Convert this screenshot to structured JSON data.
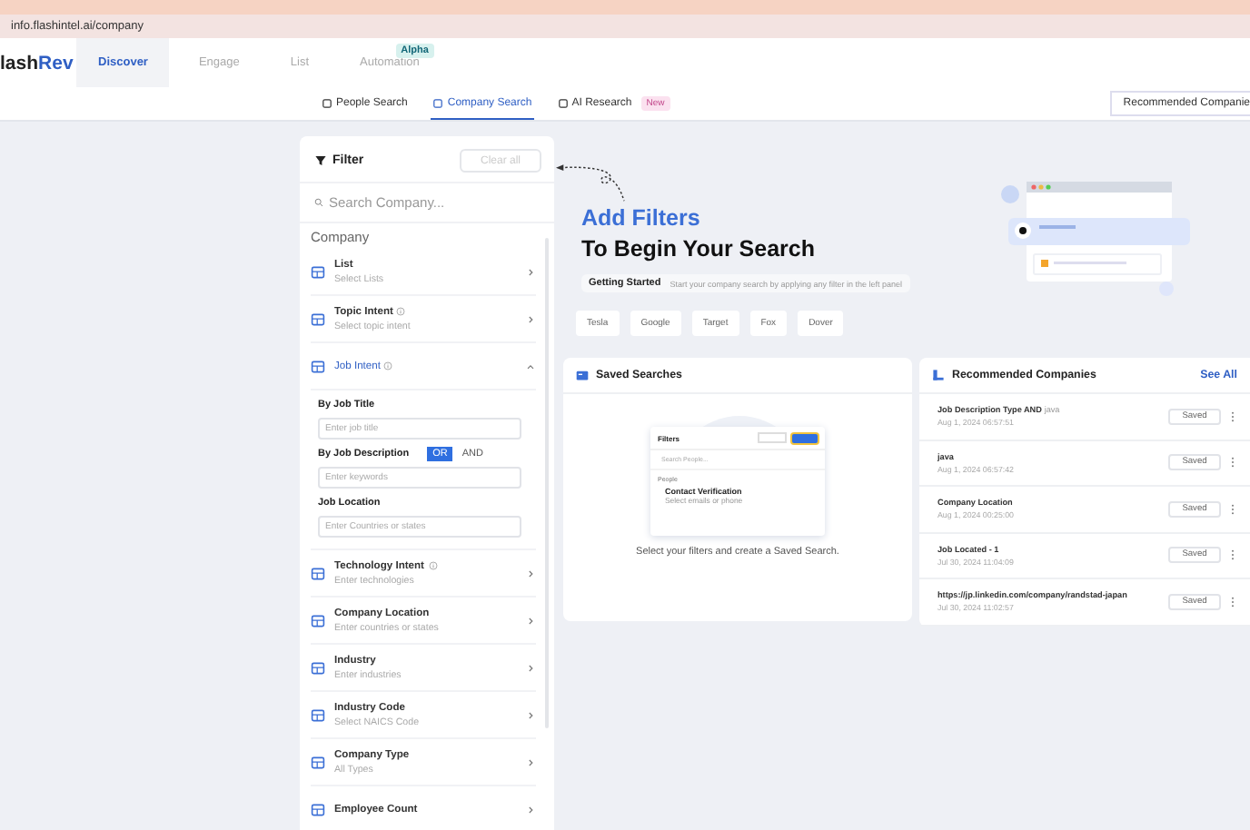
{
  "browser": {
    "url": "info.flashintel.ai/company"
  },
  "nav": {
    "logo_main": "lash",
    "logo_accent": "Rev",
    "tabs": [
      {
        "label": "Discover",
        "selected": true
      },
      {
        "label": "Engage",
        "selected": false
      },
      {
        "label": "List",
        "selected": false
      },
      {
        "label": "Automation",
        "selected": false,
        "badge": "Alpha"
      }
    ]
  },
  "subnav": {
    "tabs": [
      {
        "label": "People Search",
        "selected": false
      },
      {
        "label": "Company Search",
        "selected": true
      },
      {
        "label": "AI Research",
        "selected": false,
        "badge": "New"
      }
    ],
    "dropdown": "Recommended Companie"
  },
  "filter": {
    "title": "Filter",
    "clear_button": "Clear all",
    "search_placeholder": "Search Company...",
    "section": "Company",
    "items": [
      {
        "title": "List",
        "subtitle": "Select Lists",
        "info": false,
        "expanded": false
      },
      {
        "title": "Topic Intent",
        "subtitle": "Select topic intent",
        "info": true,
        "expanded": false
      },
      {
        "title": "Job Intent",
        "info": true,
        "expanded": true,
        "fields": [
          {
            "label": "By Job Title",
            "placeholder": "Enter job title"
          },
          {
            "label": "By Job Description",
            "placeholder": "Enter keywords",
            "toggle": [
              {
                "label": "OR",
                "selected": true
              },
              {
                "label": "AND",
                "selected": false
              }
            ]
          },
          {
            "label": "Job Location",
            "placeholder": "Enter Countries or states"
          }
        ]
      },
      {
        "title": "Technology Intent",
        "subtitle": "Enter technologies",
        "info": true,
        "expanded": false
      },
      {
        "title": "Company Location",
        "subtitle": "Enter countries or states",
        "info": false,
        "expanded": false
      },
      {
        "title": "Industry",
        "subtitle": "Enter industries",
        "info": false,
        "expanded": false
      },
      {
        "title": "Industry Code",
        "subtitle": "Select NAICS Code",
        "info": false,
        "expanded": false
      },
      {
        "title": "Company Type",
        "subtitle": "All Types",
        "info": false,
        "expanded": false
      },
      {
        "title": "Employee Count",
        "info": false,
        "expanded": false
      }
    ]
  },
  "hero": {
    "title": "Add Filters",
    "subtitle": "To Begin Your Search",
    "getting_started": "Getting Started",
    "hint": "Start your company search by applying any filter in the left panel",
    "chips": [
      "Tesla",
      "Google",
      "Target",
      "Fox",
      "Dover"
    ]
  },
  "saved_searches": {
    "title": "Saved Searches",
    "illustration": {
      "title": "Filters",
      "search": "Search People...",
      "section": "People",
      "item_title": "Contact Verification",
      "item_subtitle": "Select emails or phone"
    },
    "caption": "Select your filters and create a Saved Search."
  },
  "recommended": {
    "title": "Recommended Companies",
    "see_all": "See All",
    "rows": [
      {
        "title": "Job Description Type AND",
        "extra": "java",
        "date": "Aug 1, 2024 06:57:51",
        "button": "Saved"
      },
      {
        "title": "java",
        "date": "Aug 1, 2024 06:57:42",
        "button": "Saved"
      },
      {
        "title": "Company Location",
        "date": "Aug 1, 2024 00:25:00",
        "button": "Saved"
      },
      {
        "title": "Job Located - 1",
        "date": "Jul 30, 2024 11:04:09",
        "button": "Saved"
      },
      {
        "title": "https://jp.linkedin.com/company/randstad-japan",
        "date": "Jul 30, 2024 11:02:57",
        "button": "Saved"
      }
    ]
  }
}
